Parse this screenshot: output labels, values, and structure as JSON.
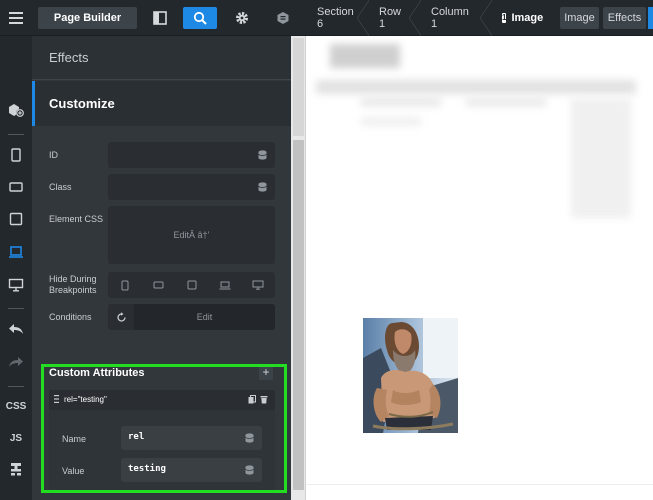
{
  "toolbar": {
    "page_builder_label": "Page Builder",
    "icons": [
      "hamburger-icon",
      "panel-toggle-icon",
      "search-icon",
      "gear-icon",
      "wordpress-icon"
    ]
  },
  "breadcrumbs": [
    {
      "label": "Section 6"
    },
    {
      "label": "Row 1"
    },
    {
      "label": "Column 1"
    },
    {
      "label": "Image",
      "badge": "1"
    }
  ],
  "top_tabs": {
    "image": "Image",
    "effects": "Effects"
  },
  "rail": {
    "css": "CSS",
    "js": "JS"
  },
  "panel": {
    "effects_label": "Effects",
    "customize_label": "Customize",
    "fields": {
      "id": {
        "label": "ID",
        "value": ""
      },
      "class": {
        "label": "Class",
        "value": ""
      },
      "element_css": {
        "label": "Element CSS",
        "button": "EditÂ â†’"
      },
      "hide_during": {
        "label_line1": "Hide During",
        "label_line2": "Breakpoints"
      },
      "conditions": {
        "label": "Conditions",
        "button": "Edit"
      }
    },
    "custom_attributes": {
      "title": "Custom Attributes",
      "add": "+",
      "item": {
        "summary": "rel=\"testing\"",
        "name_label": "Name",
        "name_value": "rel",
        "value_label": "Value",
        "value_value": "testing"
      }
    }
  },
  "colors": {
    "accent": "#1e88e5",
    "highlight": "#22dd22"
  }
}
